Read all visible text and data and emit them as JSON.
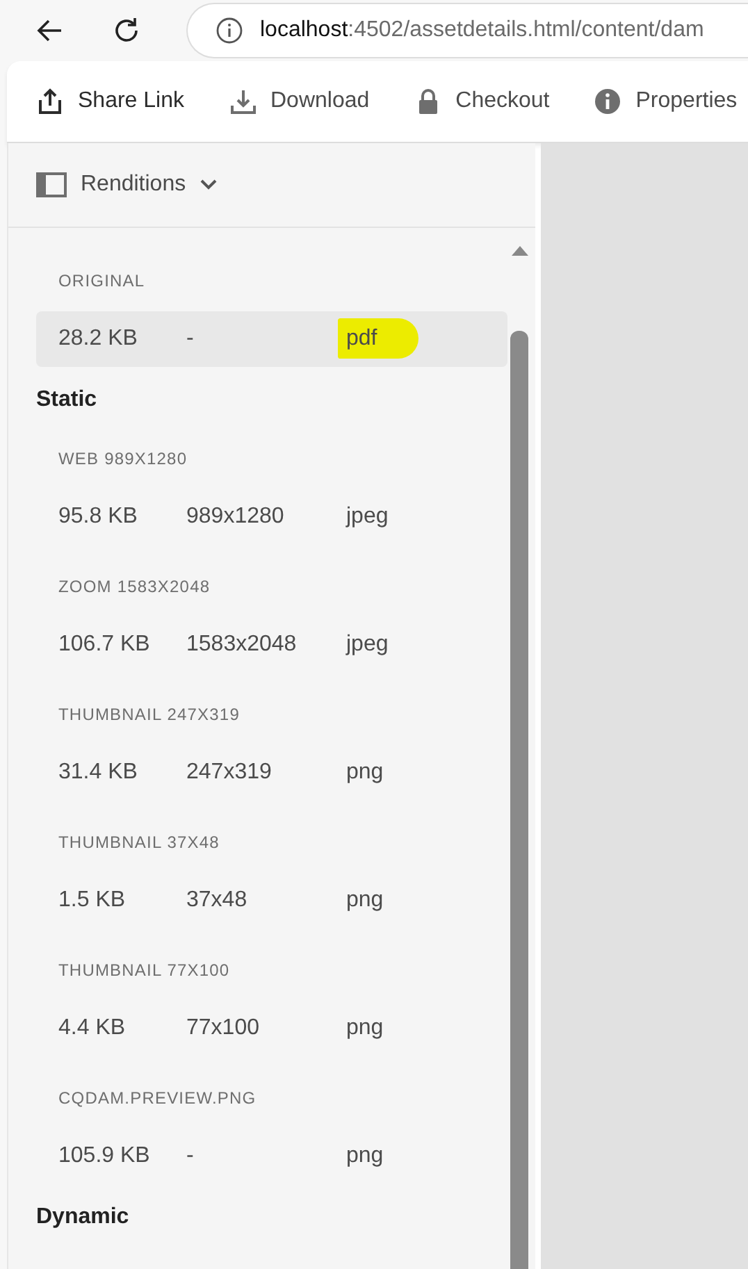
{
  "browser": {
    "url_host": "localhost",
    "url_path": ":4502/assetdetails.html/content/dam"
  },
  "toolbar": [
    {
      "label": "Share Link",
      "kind": "share"
    },
    {
      "label": "Download",
      "kind": "download"
    },
    {
      "label": "Checkout",
      "kind": "lock"
    },
    {
      "label": "Properties",
      "kind": "info"
    }
  ],
  "rail": {
    "label": "Renditions"
  },
  "original": {
    "label": "ORIGINAL",
    "size": "28.2 KB",
    "dimensions": "-",
    "format": "pdf",
    "selected": true,
    "highlighted": true
  },
  "groups": [
    {
      "heading": "Static",
      "renditions": [
        {
          "label": "WEB 989X1280",
          "size": "95.8 KB",
          "dimensions": "989x1280",
          "format": "jpeg",
          "selected": false
        },
        {
          "label": "ZOOM 1583X2048",
          "size": "106.7 KB",
          "dimensions": "1583x2048",
          "format": "jpeg",
          "selected": false
        },
        {
          "label": "THUMBNAIL 247X319",
          "size": "31.4 KB",
          "dimensions": "247x319",
          "format": "png",
          "selected": false
        },
        {
          "label": "THUMBNAIL 37X48",
          "size": "1.5 KB",
          "dimensions": "37x48",
          "format": "png",
          "selected": false
        },
        {
          "label": "THUMBNAIL 77X100",
          "size": "4.4 KB",
          "dimensions": "77x100",
          "format": "png",
          "selected": false
        },
        {
          "label": "CQDAM.PREVIEW.PNG",
          "size": "105.9 KB",
          "dimensions": "-",
          "format": "png",
          "selected": false
        }
      ]
    },
    {
      "heading": "Dynamic"
    }
  ]
}
